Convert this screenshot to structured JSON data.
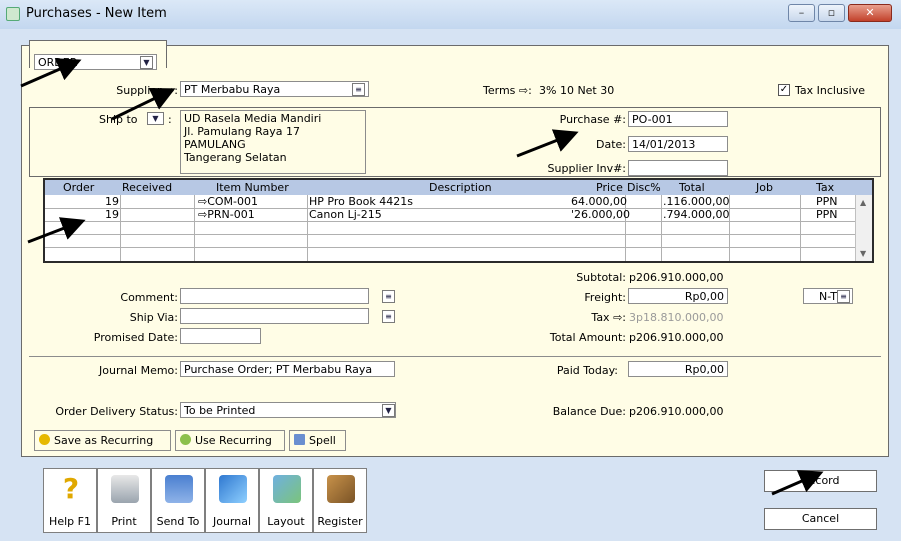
{
  "window": {
    "title": "Purchases - New Item",
    "controls": {
      "minimize": "–",
      "maximize": "▫",
      "close": "✕"
    }
  },
  "order_type": {
    "value": "ORDER"
  },
  "supplier": {
    "label": "Supplier ⇨:",
    "value": "PT Merbabu Raya"
  },
  "terms": {
    "label": "Terms ⇨:",
    "value": "3% 10 Net 30"
  },
  "tax_inclusive": {
    "label": "Tax Inclusive",
    "checked": true
  },
  "ship_to": {
    "label": "Ship to",
    "lines": [
      "UD Rasela Media Mandiri",
      "Jl. Pamulang Raya 17 PAMULANG",
      "Tangerang Selatan"
    ]
  },
  "purchase_no": {
    "label": "Purchase #:",
    "value": "PO-001"
  },
  "date": {
    "label": "Date:",
    "value": "14/01/2013"
  },
  "supplier_inv": {
    "label": "Supplier Inv#:",
    "value": ""
  },
  "lines_table": {
    "headers": [
      "Order",
      "Received",
      "Item Number",
      "Description",
      "Price",
      "Disc%",
      "Total",
      "Job",
      "Tax"
    ],
    "rows": [
      [
        "19",
        "",
        "⇨COM-001",
        "HP Pro Book 4421s",
        "64.000,00",
        "",
        ".116.000,00",
        "",
        "PPN"
      ],
      [
        "19",
        "",
        "⇨PRN-001",
        "Canon Lj-215",
        "'26.000,00",
        "",
        ".794.000,00",
        "",
        "PPN"
      ]
    ]
  },
  "totals": {
    "subtotal_label": "Subtotal:",
    "subtotal": "p206.910.000,00",
    "freight_label": "Freight:",
    "freight": "Rp0,00",
    "freight_tax": "N-T",
    "tax_label": "Tax ⇨:",
    "tax": "3p18.810.000,00",
    "total_label": "Total Amount:",
    "total": "p206.910.000,00",
    "paid_label": "Paid Today:",
    "paid": "Rp0,00",
    "balance_label": "Balance Due:",
    "balance": "p206.910.000,00"
  },
  "comment": {
    "label": "Comment:",
    "value": ""
  },
  "ship_via": {
    "label": "Ship Via:",
    "value": ""
  },
  "promised_date": {
    "label": "Promised Date:",
    "value": ""
  },
  "journal_memo": {
    "label": "Journal Memo:",
    "value": "Purchase Order; PT Merbabu Raya"
  },
  "delivery_status": {
    "label": "Order Delivery Status:",
    "value": "To be Printed"
  },
  "actions": {
    "save_recurring": "Save as Recurring",
    "use_recurring": "Use Recurring",
    "spell": "Spell"
  },
  "toolbar": {
    "help": "Help F1",
    "print": "Print",
    "send_to": "Send To",
    "journal": "Journal",
    "layout": "Layout",
    "register": "Register"
  },
  "buttons": {
    "record": "Record",
    "cancel": "Cancel"
  },
  "colors": {
    "form_bg": "#fffde6",
    "window_bg": "#d6e3f3",
    "grid_header": "#b7c8e4"
  }
}
